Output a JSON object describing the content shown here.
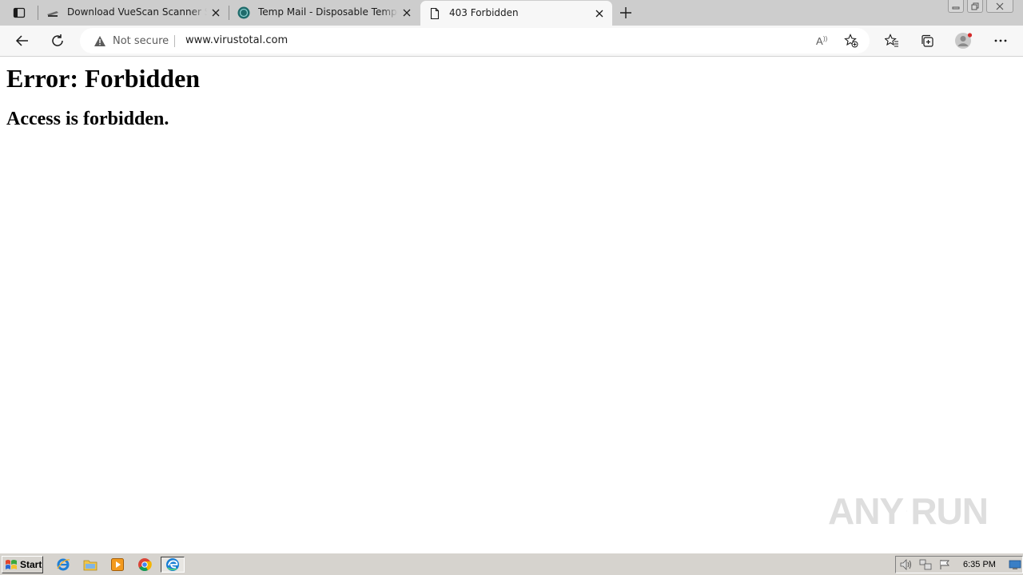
{
  "browser": {
    "tabs": [
      {
        "title": "Download VueScan Scanner Software",
        "favicon": "scanner-icon",
        "active": false
      },
      {
        "title": "Temp Mail - Disposable Temporary Email",
        "favicon": "tempmail-icon",
        "active": false
      },
      {
        "title": "403 Forbidden",
        "favicon": "document-icon",
        "active": true
      }
    ],
    "security_label": "Not secure",
    "url": "www.virustotal.com",
    "toolbar_icons": [
      "back-icon",
      "refresh-icon",
      "read-aloud-icon",
      "add-favorite-icon",
      "favorites-icon",
      "collections-icon",
      "profile-icon",
      "more-icon"
    ]
  },
  "page": {
    "heading": "Error: Forbidden",
    "message": "Access is forbidden."
  },
  "watermark": {
    "left": "ANY",
    "right": "RUN"
  },
  "taskbar": {
    "start_label": "Start",
    "pinned": [
      "internet-explorer-icon",
      "folder-icon",
      "media-player-icon",
      "chrome-icon",
      "edge-icon"
    ],
    "tray_icons": [
      "volume-icon",
      "network-icon",
      "flag-icon",
      "desktop-icon"
    ],
    "clock": "6:35 PM"
  }
}
